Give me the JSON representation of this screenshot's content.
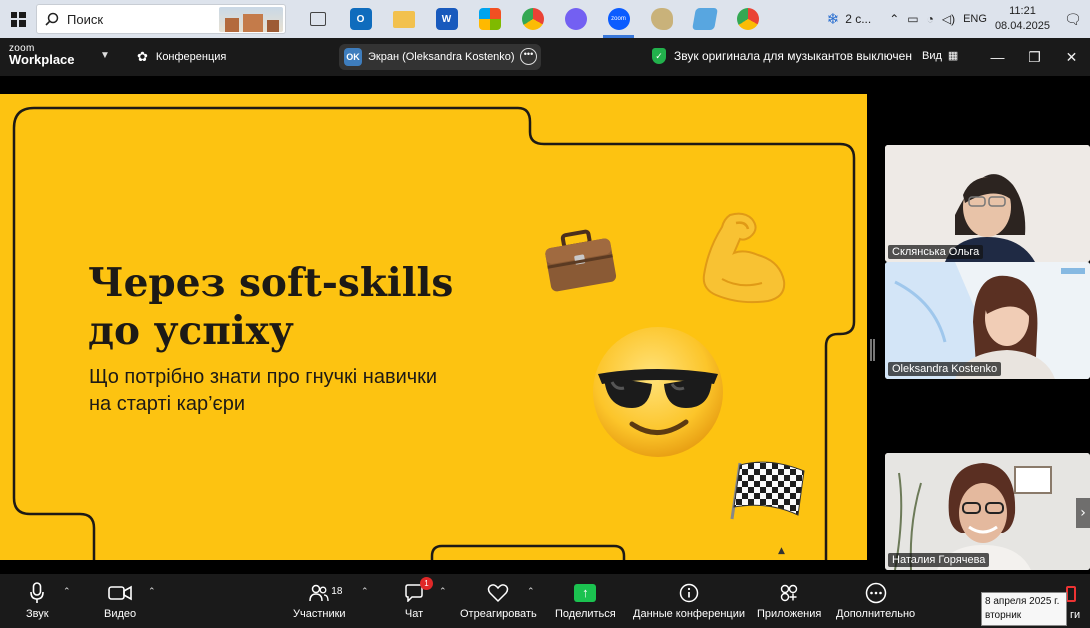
{
  "taskbar": {
    "search_placeholder": "Поиск",
    "apps": [
      {
        "name": "task-view",
        "label": "",
        "color": "#dde3ec"
      },
      {
        "name": "outlook",
        "label": "O",
        "color": "#0f6cbd"
      },
      {
        "name": "file-explorer",
        "label": "",
        "color": "#f2c14e"
      },
      {
        "name": "word",
        "label": "W",
        "color": "#185abd"
      },
      {
        "name": "ms-store",
        "label": "",
        "color": "#ffffff"
      },
      {
        "name": "chrome",
        "label": "",
        "color": "#34a853"
      },
      {
        "name": "viber",
        "label": "",
        "color": "#7360f2"
      },
      {
        "name": "zoom",
        "label": "zoom",
        "color": "#0b5cff"
      },
      {
        "name": "paint",
        "label": "",
        "color": "#c9b27a"
      },
      {
        "name": "notepad",
        "label": "",
        "color": "#58a6e0"
      },
      {
        "name": "chrome-2",
        "label": "",
        "color": "#34a853"
      }
    ],
    "weather": "2 с...",
    "lang": "ENG",
    "time": "11:21",
    "date": "08.04.2025"
  },
  "zoom_header": {
    "logo_top": "zoom",
    "logo_bottom": "Workplace",
    "conference_label": "Конференция",
    "screen_initials": "OK",
    "screen_label": "Экран (Oleksandra Kostenko)",
    "audio_status": "Звук оригинала для музыкантов выключен",
    "view_label": "Вид"
  },
  "slide": {
    "title_line1": "Через soft-skills",
    "title_line2": "до успіху",
    "subtitle_line1": "Що потрібно знати про гнучкі навички",
    "subtitle_line2": "на старті кар’єри",
    "bg_color": "#fdc311"
  },
  "participants": [
    {
      "name": "Склянська Ольга"
    },
    {
      "name": "Oleksandra Kostenko"
    },
    {
      "name": "Наталия Горячева"
    }
  ],
  "toolbar": {
    "audio": "Звук",
    "video": "Видео",
    "participants": "Участники",
    "participants_count": "18",
    "chat": "Чат",
    "chat_badge": "1",
    "react": "Отреагировать",
    "share": "Поделиться",
    "meeting_info": "Данные конференции",
    "apps": "Приложения",
    "more": "Дополнительно",
    "end_fragment": "ги"
  },
  "tooltip": {
    "line1": "8 апреля 2025 г.",
    "line2": "вторник"
  }
}
